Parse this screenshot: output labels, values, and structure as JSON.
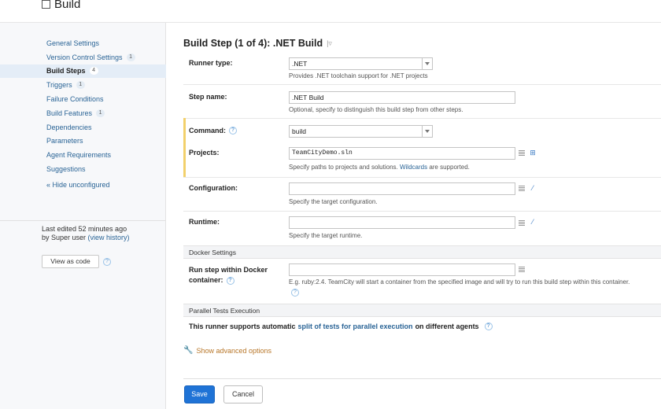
{
  "header": {
    "title": "Build"
  },
  "sidebar": {
    "items": [
      {
        "label": "General Settings",
        "badge": ""
      },
      {
        "label": "Version Control Settings",
        "badge": "1"
      },
      {
        "label": "Build Steps",
        "badge": "4",
        "active": true
      },
      {
        "label": "Triggers",
        "badge": "1"
      },
      {
        "label": "Failure Conditions",
        "badge": ""
      },
      {
        "label": "Build Features",
        "badge": "1"
      },
      {
        "label": "Dependencies",
        "badge": ""
      },
      {
        "label": "Parameters",
        "badge": ""
      },
      {
        "label": "Agent Requirements",
        "badge": ""
      },
      {
        "label": "Suggestions",
        "badge": ""
      }
    ],
    "hide_unconfigured": "« Hide unconfigured",
    "last_edited_prefix": "Last edited 52 minutes ago",
    "last_edited_by": "by Super user",
    "view_history": "(view history)",
    "view_as_code": "View as code"
  },
  "main": {
    "title": "Build Step (1 of 4): .NET Build",
    "runner_type": {
      "label": "Runner type:",
      "value": ".NET",
      "hint": "Provides .NET toolchain support for .NET projects"
    },
    "step_name": {
      "label": "Step name:",
      "value": ".NET Build",
      "hint": "Optional, specify to distinguish this build step from other steps."
    },
    "command": {
      "label": "Command:",
      "value": "build"
    },
    "projects": {
      "label": "Projects:",
      "value": "TeamCityDemo.sln",
      "hint_a": "Specify paths to projects and solutions. ",
      "hint_link": "Wildcards",
      "hint_b": " are supported."
    },
    "configuration": {
      "label": "Configuration:",
      "value": "",
      "hint": "Specify the target configuration."
    },
    "runtime": {
      "label": "Runtime:",
      "value": "",
      "hint": "Specify the target runtime."
    },
    "docker_section": "Docker Settings",
    "docker": {
      "label_line1": "Run step within Docker",
      "label_line2": "container:",
      "value": "",
      "hint": "E.g. ruby:2.4. TeamCity will start a container from the specified image and will try to run this build step within this container."
    },
    "parallel_section": "Parallel Tests Execution",
    "parallel": {
      "text_a": "This runner supports automatic ",
      "link": "split of tests for parallel execution",
      "text_b": " on different agents"
    },
    "advanced": "Show advanced options",
    "save": "Save",
    "cancel": "Cancel"
  },
  "icons": {
    "help": "question-circle-icon",
    "tree": "tree-picker-icon",
    "wand": "magic-wand-icon",
    "wrench": "wrench-icon",
    "list": "list-icon"
  }
}
